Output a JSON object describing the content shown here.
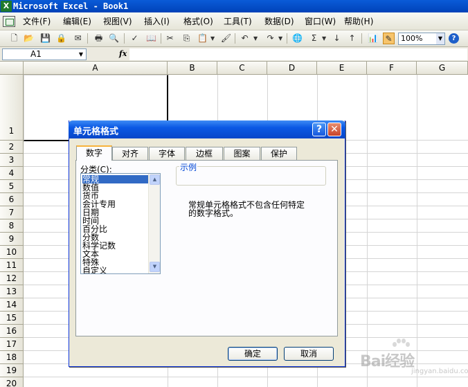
{
  "window": {
    "title": "Microsoft Excel - Book1",
    "logo": "X"
  },
  "menu": [
    "文件(F)",
    "编辑(E)",
    "视图(V)",
    "插入(I)",
    "格式(O)",
    "工具(T)",
    "数据(D)",
    "窗口(W)",
    "帮助(H)"
  ],
  "toolbar": {
    "zoom": "100%",
    "help": "?"
  },
  "formula_bar": {
    "cell_ref": "A1",
    "fx": "fx",
    "value": ""
  },
  "grid": {
    "columns": [
      "A",
      "B",
      "C",
      "D",
      "E",
      "F",
      "G"
    ],
    "rows": [
      "1",
      "2",
      "3",
      "4",
      "5",
      "6",
      "7",
      "8",
      "9",
      "10",
      "11",
      "12",
      "13",
      "14",
      "15",
      "16",
      "17",
      "18",
      "19",
      "20"
    ]
  },
  "dialog": {
    "title": "单元格格式",
    "help": "?",
    "close": "✕",
    "tabs": [
      "数字",
      "对齐",
      "字体",
      "边框",
      "图案",
      "保护"
    ],
    "active_tab": "数字",
    "category_label": "分类(C):",
    "categories": [
      "常规",
      "数值",
      "货币",
      "会计专用",
      "日期",
      "时间",
      "百分比",
      "分数",
      "科学记数",
      "文本",
      "特殊",
      "自定义"
    ],
    "selected_category": "常规",
    "sample_label": "示例",
    "description_line1": "常规单元格格式不包含任何特定",
    "description_line2": "的数字格式。",
    "ok": "确定",
    "cancel": "取消"
  },
  "watermark": {
    "text": "Bai经验",
    "sub": "jingyan.baidu.com"
  }
}
